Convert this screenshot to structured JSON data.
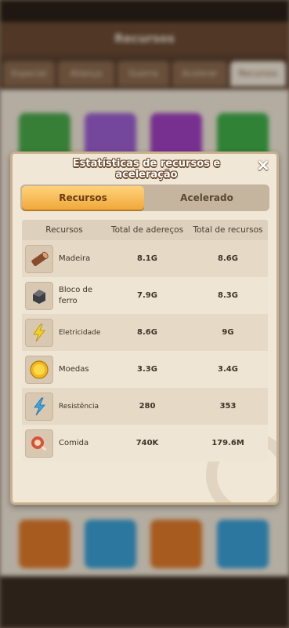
{
  "background": {
    "header_title": "Recursos",
    "tabs": [
      "Especial",
      "Aliança",
      "Guerra",
      "Acelerar",
      "Recursos"
    ]
  },
  "modal": {
    "title": "Estatísticas de recursos e aceleração",
    "close_icon": "close-icon",
    "tabs": {
      "active": "Recursos",
      "inactive": "Acelerado"
    },
    "columns": [
      "Recursos",
      "Total de adereços",
      "Total de recursos"
    ],
    "rows": [
      {
        "icon": "wood-icon",
        "name": "Madeira",
        "items_total": "8.1G",
        "resources_total": "8.6G"
      },
      {
        "icon": "iron-block-icon",
        "name": "Bloco de ferro",
        "items_total": "7.9G",
        "resources_total": "8.3G"
      },
      {
        "icon": "lightning-icon",
        "name": "Eletricidade",
        "items_total": "8.6G",
        "resources_total": "9G"
      },
      {
        "icon": "coin-icon",
        "name": "Moedas",
        "items_total": "3.3G",
        "resources_total": "3.4G"
      },
      {
        "icon": "resistance-icon",
        "name": "Resistência",
        "items_total": "280",
        "resources_total": "353"
      },
      {
        "icon": "food-icon",
        "name": "Comida",
        "items_total": "740K",
        "resources_total": "179.6M"
      }
    ]
  },
  "colors": {
    "accent": "#f0a93b",
    "panel": "#f1e7d7",
    "frame": "#c9b08d"
  }
}
